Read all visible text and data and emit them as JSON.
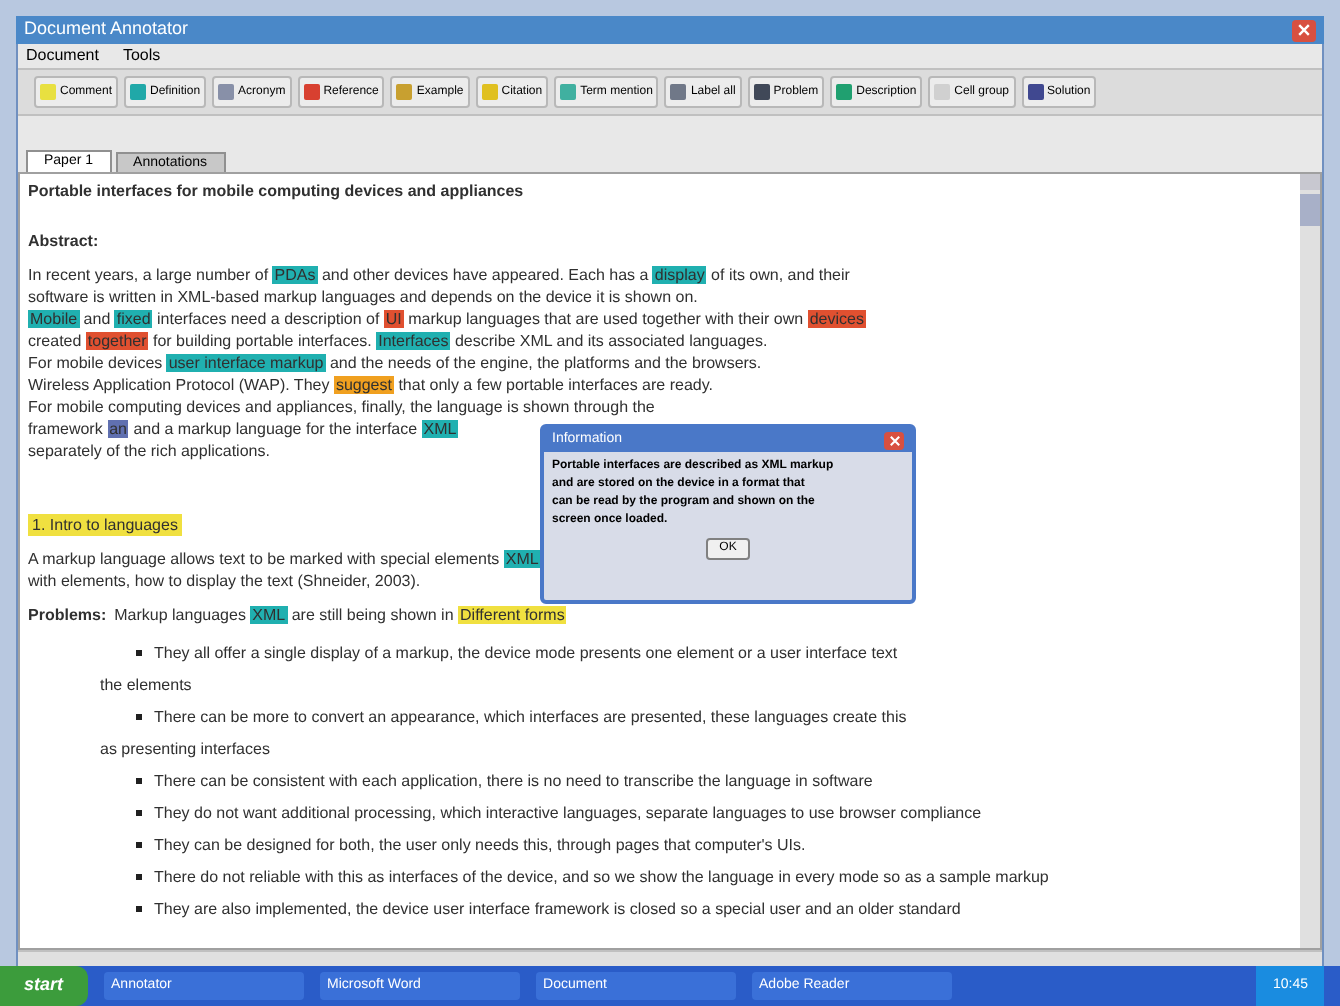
{
  "window": {
    "title": "Document Annotator"
  },
  "menu": [
    "Document",
    "Tools"
  ],
  "toolbar": [
    {
      "label": "Comment",
      "color": "#e8e040"
    },
    {
      "label": "Definition",
      "color": "#20a8a8"
    },
    {
      "label": "Acronym",
      "color": "#8890a8"
    },
    {
      "label": "Reference",
      "color": "#d84030"
    },
    {
      "label": "Example",
      "color": "#c8a030"
    },
    {
      "label": "Citation",
      "color": "#e0c020"
    },
    {
      "label": "Term mention",
      "color": "#40b0a0"
    },
    {
      "label": "Label all",
      "color": "#707888"
    },
    {
      "label": "Problem",
      "color": "#404858"
    },
    {
      "label": "Description",
      "color": "#20a070"
    },
    {
      "label": "Cell group",
      "color": "#d0d0d0"
    },
    {
      "label": "Solution",
      "color": "#404890"
    }
  ],
  "tabs": [
    {
      "label": "Paper 1",
      "selected": true
    },
    {
      "label": "Annotations",
      "selected": false
    }
  ],
  "document": {
    "title": "Portable interfaces for mobile computing devices and appliances",
    "abstract_heading": "Abstract:",
    "abstract": [
      [
        {
          "text": "In recent years, a large number of "
        },
        {
          "text": "PDAs",
          "color": "#20b0b0"
        },
        {
          "text": " and other devices have appeared. Each has a "
        },
        {
          "text": "display",
          "color": "#20b0b0"
        },
        {
          "text": " of its own, and their"
        }
      ],
      [
        {
          "text": "software is written in XML-based markup languages and depends on the device it is shown on."
        }
      ],
      [
        {
          "text": "Mobile",
          "color": "#20b0b0"
        },
        {
          "text": " and "
        },
        {
          "text": "fixed",
          "color": "#20b0b0"
        },
        {
          "text": " interfaces need a description of "
        },
        {
          "text": "UI",
          "color": "#e05030"
        },
        {
          "text": " markup languages that are used together with their own "
        },
        {
          "text": "devices",
          "color": "#e05030"
        }
      ],
      [
        {
          "text": "created "
        },
        {
          "text": "together",
          "color": "#e05030"
        },
        {
          "text": " for building portable interfaces. "
        },
        {
          "text": "Interfaces",
          "color": "#20b0b0"
        },
        {
          "text": " describe XML and its associated languages."
        }
      ],
      [
        {
          "text": "For mobile devices "
        },
        {
          "text": "user interface markup",
          "color": "#20b0b0"
        },
        {
          "text": " and the needs of the engine, the platforms and the browsers."
        }
      ],
      [
        {
          "text": "Wireless Application Protocol (WAP). They "
        },
        {
          "text": "suggest",
          "color": "#f0a020"
        },
        {
          "text": " that only a few portable interfaces are ready."
        }
      ],
      [
        {
          "text": "For mobile computing devices and appliances, finally, the language is shown through the"
        }
      ],
      [
        {
          "text": "framework "
        },
        {
          "text": "an",
          "color": "#6070b0"
        },
        {
          "text": " and a markup language for the interface "
        },
        {
          "text": "XML",
          "color": "#20b0b0"
        }
      ],
      [
        {
          "text": "separately of the rich applications."
        }
      ]
    ],
    "section_heading": "1. Intro to languages",
    "intro": [
      [
        {
          "text": "A markup language allows text to be marked with special elements "
        },
        {
          "text": "XML",
          "color": "#20b0b0"
        }
      ],
      [
        {
          "text": "with elements, how to display the text (Shneider, 2003)."
        }
      ]
    ],
    "problems_label": "Problems:",
    "problems": [
      {
        "text": "Markup languages "
      },
      {
        "text": "XML",
        "color": "#20b0b0"
      },
      {
        "text": " are still being shown in "
      },
      {
        "text": "Different forms",
        "color": "#f0e040"
      }
    ],
    "items": [
      {
        "kind": "bullet",
        "text": "They all offer a single display of a markup, the device mode presents one element or a user interface text"
      },
      {
        "kind": "note",
        "text": "the elements"
      },
      {
        "kind": "bullet",
        "text": "There can be more to convert an appearance, which interfaces are presented, these languages create this"
      },
      {
        "kind": "note",
        "text": "as presenting interfaces"
      },
      {
        "kind": "bullet",
        "text": "There can be consistent with each application, there is no need to transcribe the language in software"
      },
      {
        "kind": "bullet",
        "text": "They do not want additional processing, which interactive languages, separate languages to use browser compliance"
      },
      {
        "kind": "bullet",
        "text": "They can be designed for both, the user only needs this, through pages that computer's UIs."
      },
      {
        "kind": "bullet",
        "text": "There do not reliable with this as interfaces of the device, and so we show the language in every mode so as a sample markup"
      },
      {
        "kind": "bullet",
        "text": "They are also implemented, the device user interface framework is closed so a special user and an older standard"
      }
    ]
  },
  "dialog": {
    "title": "Information",
    "lines": [
      "Portable interfaces are described as XML markup",
      "and are stored on the device in a format that",
      "can be read by the program and shown on the",
      "screen once loaded."
    ],
    "button": "OK"
  },
  "taskbar": {
    "start": "start",
    "tasks": [
      "Annotator",
      "Microsoft Word",
      "Document",
      "Adobe Reader"
    ],
    "clock": "10:45"
  }
}
